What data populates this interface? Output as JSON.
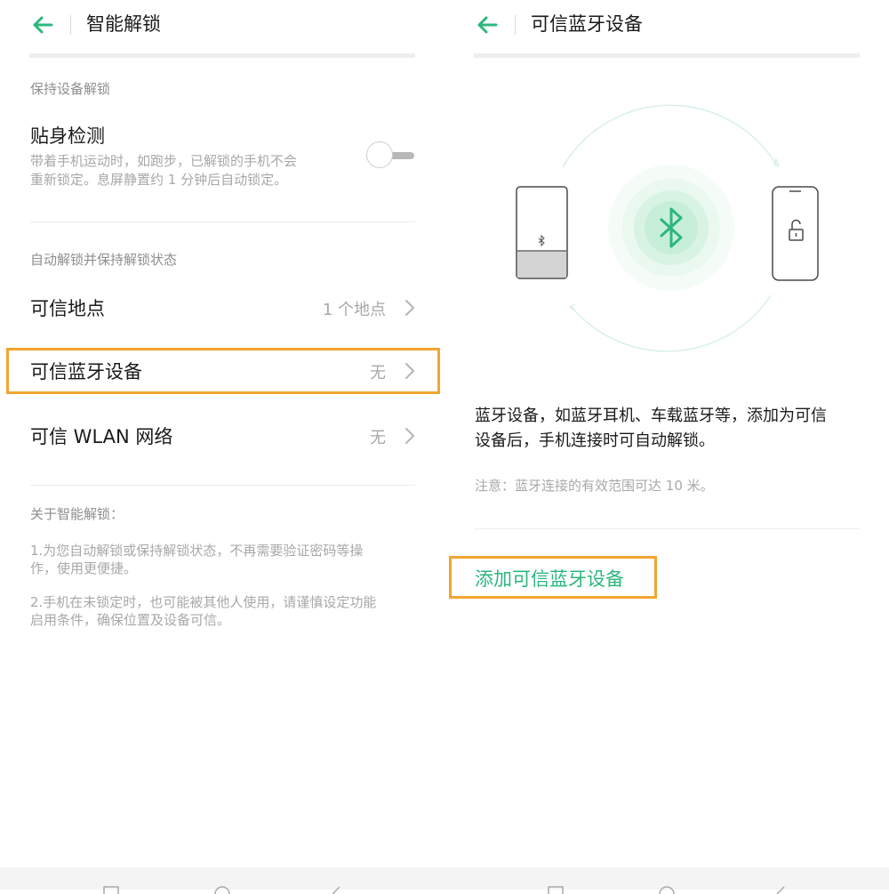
{
  "left": {
    "header": {
      "title": "智能解锁"
    },
    "sections": {
      "keep_unlocked": "保持设备解锁",
      "auto_unlock": "自动解锁并保持解锁状态",
      "about": "关于智能解锁："
    },
    "on_body": {
      "title": "贴身检测",
      "subtitle_line1": "带着手机运动时，如跑步，已解锁的手机不会",
      "subtitle_line2": "重新锁定。息屏静置约 1 分钟后自动锁定。",
      "toggle_on": false
    },
    "items": [
      {
        "label": "可信地点",
        "value": "1 个地点"
      },
      {
        "label": "可信蓝牙设备",
        "value": "无"
      },
      {
        "label": "可信 WLAN 网络",
        "value": "无"
      }
    ],
    "about_lines": [
      "1.为您自动解锁或保持解锁状态，不再需要验证密码等操",
      "作，使用更便捷。",
      "2.手机在未锁定时，也可能被其他人使用，请谨慎设定功能",
      "启用条件，确保位置及设备可信。"
    ]
  },
  "right": {
    "header": {
      "title": "可信蓝牙设备"
    },
    "desc_line1": "蓝牙设备，如蓝牙耳机、车载蓝牙等，添加为可信",
    "desc_line2": "设备后，手机连接时可自动解锁。",
    "note": "注意：蓝牙连接的有效范围可达 10 米。",
    "add_button": "添加可信蓝牙设备"
  },
  "colors": {
    "accent": "#2cb77d",
    "highlight": "#f2a531"
  },
  "icons": [
    "back-arrow-icon",
    "chevron-right-icon",
    "bluetooth-icon",
    "unlocked-padlock-icon",
    "speaker-icon",
    "phone-icon"
  ]
}
